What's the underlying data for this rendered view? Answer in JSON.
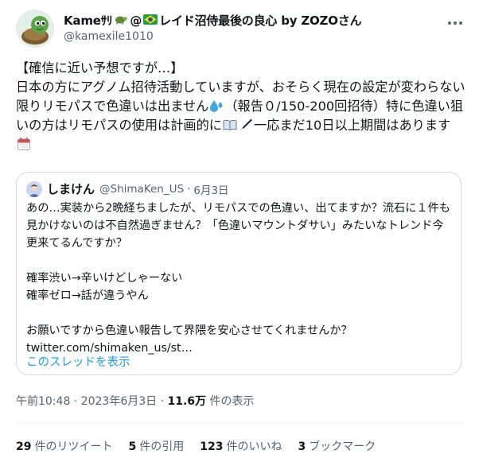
{
  "author": {
    "display_name_part1": "Kameｻﾘ",
    "display_name_part2": "@",
    "display_name_part3": "レイド沼侍最後の良心 by ZOZOさん",
    "handle": "@kamexile1010"
  },
  "tweet": {
    "text_part1": "【確信に近い予想ですが…】\n日本の方にアグノム招待活動していますが、おそらく現在の設定が変わらない限りリモパスで色違いは出ません",
    "text_part2": "（報告０/150-200回招待）特に色違い狙いの方はリモパスの使用は計画的に",
    "text_part3": "一応まだ10日以上期間はあります"
  },
  "quote": {
    "name": "しまけん",
    "handle": "@ShimaKen_US",
    "separator": "·",
    "date": "6月3日",
    "body": "あの…実装から2晩経ちましたが、リモパスでの色違い、出てますか？流石に１件も見かけないのは不自然過ぎません？「色違いマウントダサい」みたいなトレンド今更来てるんですか？\n\n確率渋い→辛いけどしゃーない\n確率ゼロ→話が違うやん\n\nお願いですから色違い報告して界隈を安心させてくれませんか？",
    "link": "twitter.com/shimaken_us/st…",
    "show_thread": "このスレッドを表示"
  },
  "meta": {
    "time": "午前10:48 · 2023年6月3日 · ",
    "views_count": "11.6万",
    "views_label": " 件の表示"
  },
  "stats": [
    {
      "count": "29",
      "label": "件のリツイート"
    },
    {
      "count": "5",
      "label": "件の引用"
    },
    {
      "count": "123",
      "label": "件のいいね"
    },
    {
      "count": "3",
      "label": "ブックマーク"
    }
  ],
  "colors": {
    "text": "#0f1419",
    "secondary": "#536471",
    "link": "#1d9bf0",
    "border": "#cfd9de"
  }
}
